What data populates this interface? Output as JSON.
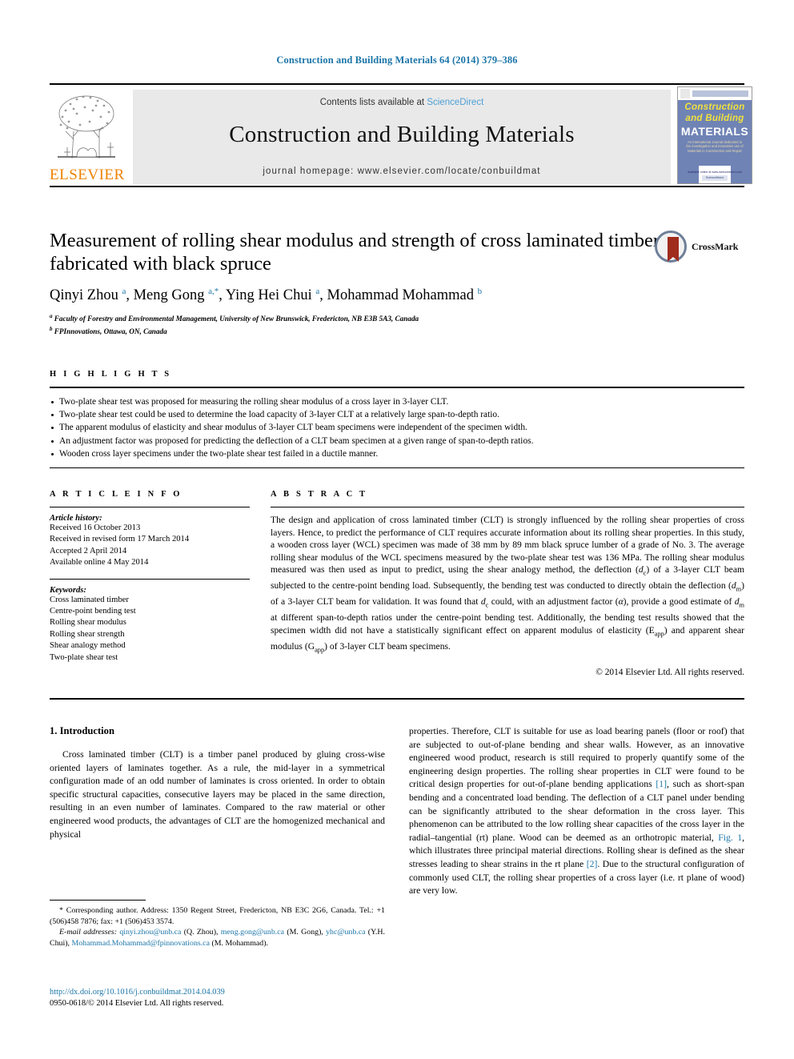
{
  "running_head": "Construction and Building Materials 64 (2014) 379–386",
  "masthead": {
    "contents_prefix": "Contents lists available at ",
    "sciencedirect": "ScienceDirect",
    "journal_title": "Construction and Building Materials",
    "homepage": "journal homepage: www.elsevier.com/locate/conbuildmat",
    "elsevier_word": "ELSEVIER",
    "cover": {
      "line1": "Construction",
      "line2": "and Building",
      "line3": "MATERIALS",
      "blurb": "An International Journal dedicated to the Investigation and innovative use of Materials in Construction and Repair",
      "footer": "Available online at www.sciencedirect.com",
      "sd_badge": "ScienceDirect"
    }
  },
  "article": {
    "title": "Measurement of rolling shear modulus and strength of cross laminated timber fabricated with black spruce",
    "crossmark_label": "CrossMark",
    "authors_html": "Qinyi Zhou <sup>a</sup>, Meng Gong <sup>a,*</sup>, Ying Hei Chui <sup>a</sup>, Mohammad Mohammad <sup>b</sup>",
    "affiliation_a": "Faculty of Forestry and Environmental Management, University of New Brunswick, Fredericton, NB E3B 5A3, Canada",
    "affiliation_b": "FPInnovations, Ottawa, ON, Canada"
  },
  "highlights": {
    "label": "H I G H L I G H T S",
    "items": [
      "Two-plate shear test was proposed for measuring the rolling shear modulus of a cross layer in 3-layer CLT.",
      "Two-plate shear test could be used to determine the load capacity of 3-layer CLT at a relatively large span-to-depth ratio.",
      "The apparent modulus of elasticity and shear modulus of 3-layer CLT beam specimens were independent of the specimen width.",
      "An adjustment factor was proposed for predicting the deflection of a CLT beam specimen at a given range of span-to-depth ratios.",
      "Wooden cross layer specimens under the two-plate shear test failed in a ductile manner."
    ]
  },
  "article_info": {
    "label": "A R T I C L E    I N F O",
    "history_label": "Article history:",
    "history": [
      "Received 16 October 2013",
      "Received in revised form 17 March 2014",
      "Accepted 2 April 2014",
      "Available online 4 May 2014"
    ],
    "keywords_label": "Keywords:",
    "keywords": [
      "Cross laminated timber",
      "Centre-point bending test",
      "Rolling shear modulus",
      "Rolling shear strength",
      "Shear analogy method",
      "Two-plate shear test"
    ]
  },
  "abstract": {
    "label": "A B S T R A C T",
    "text_html": "The design and application of cross laminated timber (CLT) is strongly influenced by the rolling shear properties of cross layers. Hence, to predict the performance of CLT requires accurate information about its rolling shear properties. In this study, a wooden cross layer (WCL) specimen was made of 38 mm by 89 mm black spruce lumber of a grade of No. 3. The average rolling shear modulus of the WCL specimens measured by the two-plate shear test was 136 MPa. The rolling shear modulus measured was then used as input to predict, using the shear analogy method, the deflection (<i>d</i><sub>c</sub>) of a 3-layer CLT beam subjected to the centre-point bending load. Subsequently, the bending test was conducted to directly obtain the deflection (<i>d</i><sub>m</sub>) of a 3-layer CLT beam for validation. It was found that <i>d</i><sub>c</sub> could, with an adjustment factor (<i>α</i>), provide a good estimate of <i>d</i><sub>m</sub> at different span-to-depth ratios under the centre-point bending test. Additionally, the bending test results showed that the specimen width did not have a statistically significant effect on apparent modulus of elasticity (E<sub>app</sub>) and apparent shear modulus (G<sub>app</sub>) of 3-layer CLT beam specimens.",
    "copyright": "© 2014 Elsevier Ltd. All rights reserved."
  },
  "body": {
    "section_heading": "1. Introduction",
    "left_paragraph": "Cross laminated timber (CLT) is a timber panel produced by gluing cross-wise oriented layers of laminates together. As a rule, the mid-layer in a symmetrical configuration made of an odd number of laminates is cross oriented. In order to obtain specific structural capacities, consecutive layers may be placed in the same direction, resulting in an even number of laminates. Compared to the raw material or other engineered wood products, the advantages of CLT are the homogenized mechanical and physical",
    "right_paragraph_html": "properties. Therefore, CLT is suitable for use as load bearing panels (floor or roof) that are subjected to out-of-plane bending and shear walls. However, as an innovative engineered wood product, research is still required to properly quantify some of the engineering design properties. The rolling shear properties in CLT were found to be critical design properties for out-of-plane bending applications <span class=\"link\">[1]</span>, such as short-span bending and a concentrated load bending. The deflection of a CLT panel under bending can be significantly attributed to the shear deformation in the cross layer. This phenomenon can be attributed to the low rolling shear capacities of the cross layer in the radial–tangential (rt) plane. Wood can be deemed as an orthotropic material, <span class=\"link\">Fig. 1</span>, which illustrates three principal material directions. Rolling shear is defined as the shear stresses leading to shear strains in the rt plane <span class=\"link\">[2]</span>. Due to the structural configuration of commonly used CLT, the rolling shear properties of a cross layer (i.e. rt plane of wood) are very low."
  },
  "footnotes": {
    "corresponding_html": "* Corresponding author. Address: 1350 Regent Street, Fredericton, NB E3C 2G6, Canada. Tel.: +1 (506)458 7876; fax: +1 (506)453 3574.",
    "email_label": "E-mail addresses:",
    "emails_html": "<span class=\"link\">qinyi.zhou@unb.ca</span> (Q. Zhou), <span class=\"link\">meng.gong@unb.ca</span> (M. Gong), <span class=\"link\">yhc@unb.ca</span> (Y.H. Chui), <span class=\"link\">Mohammad.Mohammad@fpinnovations.ca</span> (M. Mohammad)."
  },
  "doi_block": {
    "doi_url": "http://dx.doi.org/10.1016/j.conbuildmat.2014.04.039",
    "issn_line": "0950-0618/© 2014 Elsevier Ltd. All rights reserved."
  },
  "colors": {
    "link_blue": "#1b75a8",
    "sciencedirect_blue": "#4d9fd6",
    "elsevier_orange": "#ef8200",
    "cover_blue": "#6f83b5",
    "cover_yellow": "#f2e23c"
  }
}
